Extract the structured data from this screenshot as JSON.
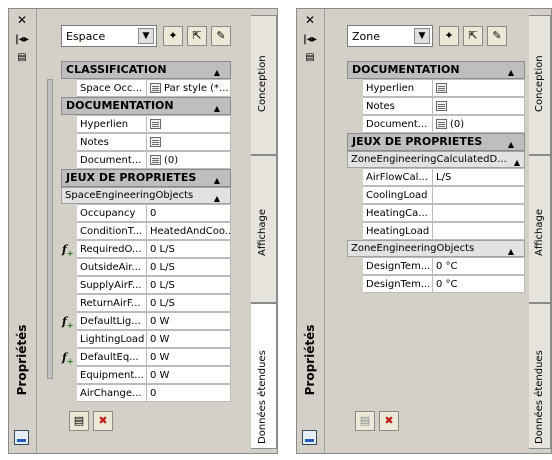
{
  "palette_title": "Propriétés",
  "palette1": {
    "style_combo": "Espace",
    "tabs": [
      "Conception",
      "Affichage",
      "Données étendues"
    ],
    "classification": {
      "label": "CLASSIFICATION",
      "rows": [
        {
          "name": "Space Occ...",
          "value": "Par style (*..."
        }
      ]
    },
    "documentation": {
      "label": "DOCUMENTATION",
      "rows": [
        {
          "name": "Hyperlien",
          "value": ""
        },
        {
          "name": "Notes",
          "value": ""
        },
        {
          "name": "Document...",
          "value": "(0)"
        }
      ]
    },
    "propsets": {
      "label": "JEUX DE PROPRIETES",
      "group": "SpaceEngineeringObjects",
      "rows": [
        {
          "name": "Occupancy",
          "value": "0",
          "fx": false
        },
        {
          "name": "ConditionT...",
          "value": "HeatedAndCoo...",
          "fx": false
        },
        {
          "name": "RequiredO...",
          "value": "0 L/S",
          "fx": true
        },
        {
          "name": "OutsideAir...",
          "value": "0 L/S",
          "fx": false
        },
        {
          "name": "SupplyAirF...",
          "value": "0 L/S",
          "fx": false
        },
        {
          "name": "ReturnAirF...",
          "value": "0 L/S",
          "fx": false
        },
        {
          "name": "DefaultLig...",
          "value": "0 W",
          "fx": true
        },
        {
          "name": "LightingLoad",
          "value": "0 W",
          "fx": false
        },
        {
          "name": "DefaultEq...",
          "value": "0 W",
          "fx": true
        },
        {
          "name": "Equipment...",
          "value": "0 W",
          "fx": false
        },
        {
          "name": "AirChange...",
          "value": "0",
          "fx": false
        }
      ]
    }
  },
  "palette2": {
    "style_combo": "Zone",
    "tabs": [
      "Conception",
      "Affichage",
      "Données étendues"
    ],
    "documentation": {
      "label": "DOCUMENTATION",
      "rows": [
        {
          "name": "Hyperlien",
          "value": ""
        },
        {
          "name": "Notes",
          "value": ""
        },
        {
          "name": "Document...",
          "value": "(0)"
        }
      ]
    },
    "propsets": {
      "label": "JEUX DE PROPRIETES",
      "group1": "ZoneEngineeringCalculatedD...",
      "rows1": [
        {
          "name": "AirFlowCal...",
          "value": "L/S"
        },
        {
          "name": "CoolingLoad",
          "value": ""
        },
        {
          "name": "HeatingCa...",
          "value": ""
        },
        {
          "name": "HeatingLoad",
          "value": ""
        }
      ],
      "group2": "ZoneEngineeringObjects",
      "rows2": [
        {
          "name": "DesignTem...",
          "value": "0 °C"
        },
        {
          "name": "DesignTem...",
          "value": "0 °C"
        }
      ]
    }
  }
}
